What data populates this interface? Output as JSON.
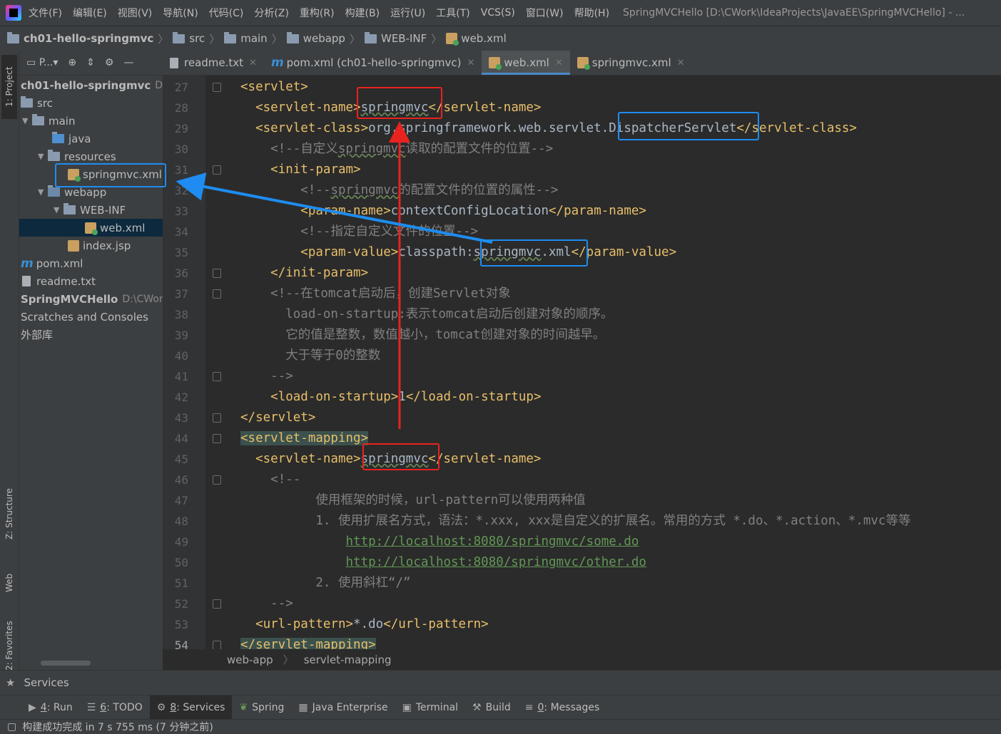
{
  "menubar": {
    "items": [
      "文件(F)",
      "编辑(E)",
      "视图(V)",
      "导航(N)",
      "代码(C)",
      "分析(Z)",
      "重构(R)",
      "构建(B)",
      "运行(U)",
      "工具(T)",
      "VCS(S)",
      "窗口(W)",
      "帮助(H)"
    ],
    "title": "SpringMVCHello [D:\\CWork\\IdeaProjects\\JavaEE\\SpringMVCHello] - ..."
  },
  "breadcrumb": [
    "ch01-hello-springmvc",
    "src",
    "main",
    "webapp",
    "WEB-INF",
    "web.xml"
  ],
  "left_strip": {
    "project": "1: Project",
    "structure": "Z: Structure",
    "web": "Web",
    "favorites": "2: Favorites"
  },
  "project_panel": {
    "toolbar_label": "P...",
    "tree": [
      {
        "label": "ch01-hello-springmvc",
        "suffix": "D:\\("
      },
      {
        "label": "src"
      },
      {
        "label": "main"
      },
      {
        "label": "java"
      },
      {
        "label": "resources"
      },
      {
        "label": "springmvc.xml"
      },
      {
        "label": "webapp"
      },
      {
        "label": "WEB-INF"
      },
      {
        "label": "web.xml"
      },
      {
        "label": "index.jsp"
      },
      {
        "label": "pom.xml"
      },
      {
        "label": "readme.txt"
      },
      {
        "label": "SpringMVCHello",
        "suffix": "D:\\CWork"
      },
      {
        "label": "Scratches and Consoles"
      },
      {
        "label": "外部库"
      }
    ]
  },
  "tabs": [
    {
      "label": "readme.txt"
    },
    {
      "label": "pom.xml (ch01-hello-springmvc)"
    },
    {
      "label": "web.xml",
      "active": true
    },
    {
      "label": "springmvc.xml"
    }
  ],
  "editor": {
    "line_numbers": [
      "27",
      "28",
      "29",
      "30",
      "31",
      "32",
      "33",
      "34",
      "35",
      "36",
      "37",
      "38",
      "39",
      "40",
      "41",
      "42",
      "43",
      "44",
      "45",
      "46",
      "47",
      "48",
      "49",
      "50",
      "51",
      "52",
      "53",
      "54"
    ],
    "lines": {
      "l27": "<servlet>",
      "l28a": "<servlet-name>",
      "l28b": "springmvc",
      "l28c": "</servlet-name>",
      "l29a": "<servlet-class>",
      "l29b": "org.springframework.web.servlet.DispatcherServlet",
      "l29c": "</servlet-class>",
      "l30a": "<!--自定义",
      "l30b": "springmvc",
      "l30c": "读取的配置文件的位置-->",
      "l31": "<init-param>",
      "l32a": "<!--",
      "l32b": "springmvc",
      "l32c": "的配置文件的位置的属性-->",
      "l33a": "<param-name>",
      "l33b": "contextConfigLocation",
      "l33c": "</param-name>",
      "l34": "<!--指定自定义文件的位置-->",
      "l35a": "<param-value>",
      "l35b": "classpath:",
      "l35c": "springmvc",
      "l35d": ".xml",
      "l35e": "</param-value>",
      "l36": "</init-param>",
      "l37": "<!--在tomcat启动后，创建Servlet对象",
      "l38": "load-on-startup:表示tomcat启动后创建对象的顺序。",
      "l39": "它的值是整数，数值越小，tomcat创建对象的时间越早。",
      "l40": "大于等于0的整数",
      "l41": "-->",
      "l42a": "<load-on-startup>",
      "l42b": "1",
      "l42c": "</load-on-startup>",
      "l43": "</servlet>",
      "l44": "<servlet-mapping>",
      "l45a": "<servlet-name>",
      "l45b": "springmvc",
      "l45c": "</servlet-name>",
      "l46": "<!--",
      "l47": "使用框架的时候，url-pattern可以使用两种值",
      "l48": "1. 使用扩展名方式，语法：*.xxx, xxx是自定义的扩展名。常用的方式 *.do、*.action、*.mvc等等",
      "l49": "http://localhost:8080/springmvc/some.do",
      "l50": "http://localhost:8080/springmvc/other.do",
      "l51": "2. 使用斜杠“/”",
      "l52": "-->",
      "l53a": "<url-pattern>",
      "l53b": "*.do",
      "l53c": "</url-pattern>",
      "l54": "</servlet-mapping>"
    }
  },
  "editor_crumbs": [
    "web-app",
    "servlet-mapping"
  ],
  "services_label": "Services",
  "toolwindows": [
    {
      "num": "4",
      "label": ": Run"
    },
    {
      "num": "6",
      "label": ": TODO"
    },
    {
      "num": "8",
      "label": ": Services",
      "active": true
    },
    {
      "num": "",
      "label": "Spring"
    },
    {
      "num": "",
      "label": "Java Enterprise"
    },
    {
      "num": "",
      "label": "Terminal"
    },
    {
      "num": "",
      "label": "Build"
    },
    {
      "num": "0",
      "label": ": Messages"
    }
  ],
  "status": "构建成功完成 in 7 s 755 ms (7 分钟之前)",
  "colors": {
    "annotation_red": "#e8231f",
    "annotation_blue": "#1e8cf0",
    "xml_tag": "#e8bf6a",
    "comment": "#808080"
  }
}
